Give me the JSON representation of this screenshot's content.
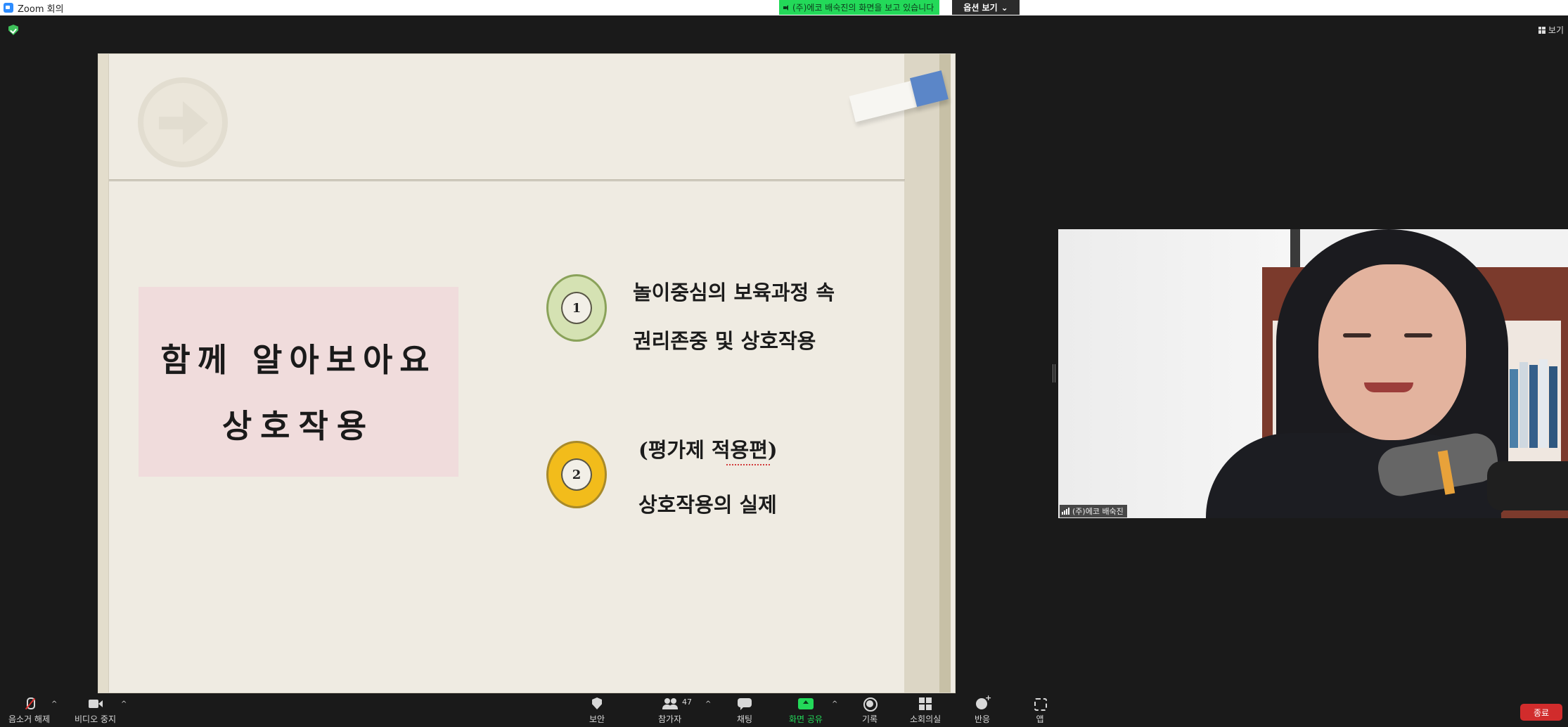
{
  "window": {
    "title": "Zoom 회의"
  },
  "share_banner": {
    "text": "(주)에코 배숙진의 화면을 보고 있습니다",
    "view_options": "옵션 보기"
  },
  "top_right": {
    "view_label": "보기"
  },
  "slide": {
    "title_line1": "함께 알아보아요",
    "title_line2": "상호작용",
    "items": [
      {
        "number": "1",
        "line1": "놀이중심의 보육과정 속",
        "line2": "권리존중 및 상호작용"
      },
      {
        "number": "2",
        "line1": "(평가제 적용편)",
        "line2": "상호작용의 실제"
      }
    ]
  },
  "video": {
    "participant_name": "(주)에코 배숙진"
  },
  "toolbar": {
    "unmute": "음소거 해제",
    "stop_video": "비디오 중지",
    "security": "보안",
    "participants": "참가자",
    "participants_count": "47",
    "chat": "채팅",
    "share_screen": "화면 공유",
    "record": "기록",
    "breakout_rooms": "소회의실",
    "reactions": "반응",
    "apps": "앱",
    "end": "종료"
  },
  "colors": {
    "share_green": "#23d959",
    "end_red": "#d12c2c",
    "item1_circle": "#d5e2b3",
    "item2_circle": "#f2bc1b",
    "title_box": "#f0dcdc"
  }
}
